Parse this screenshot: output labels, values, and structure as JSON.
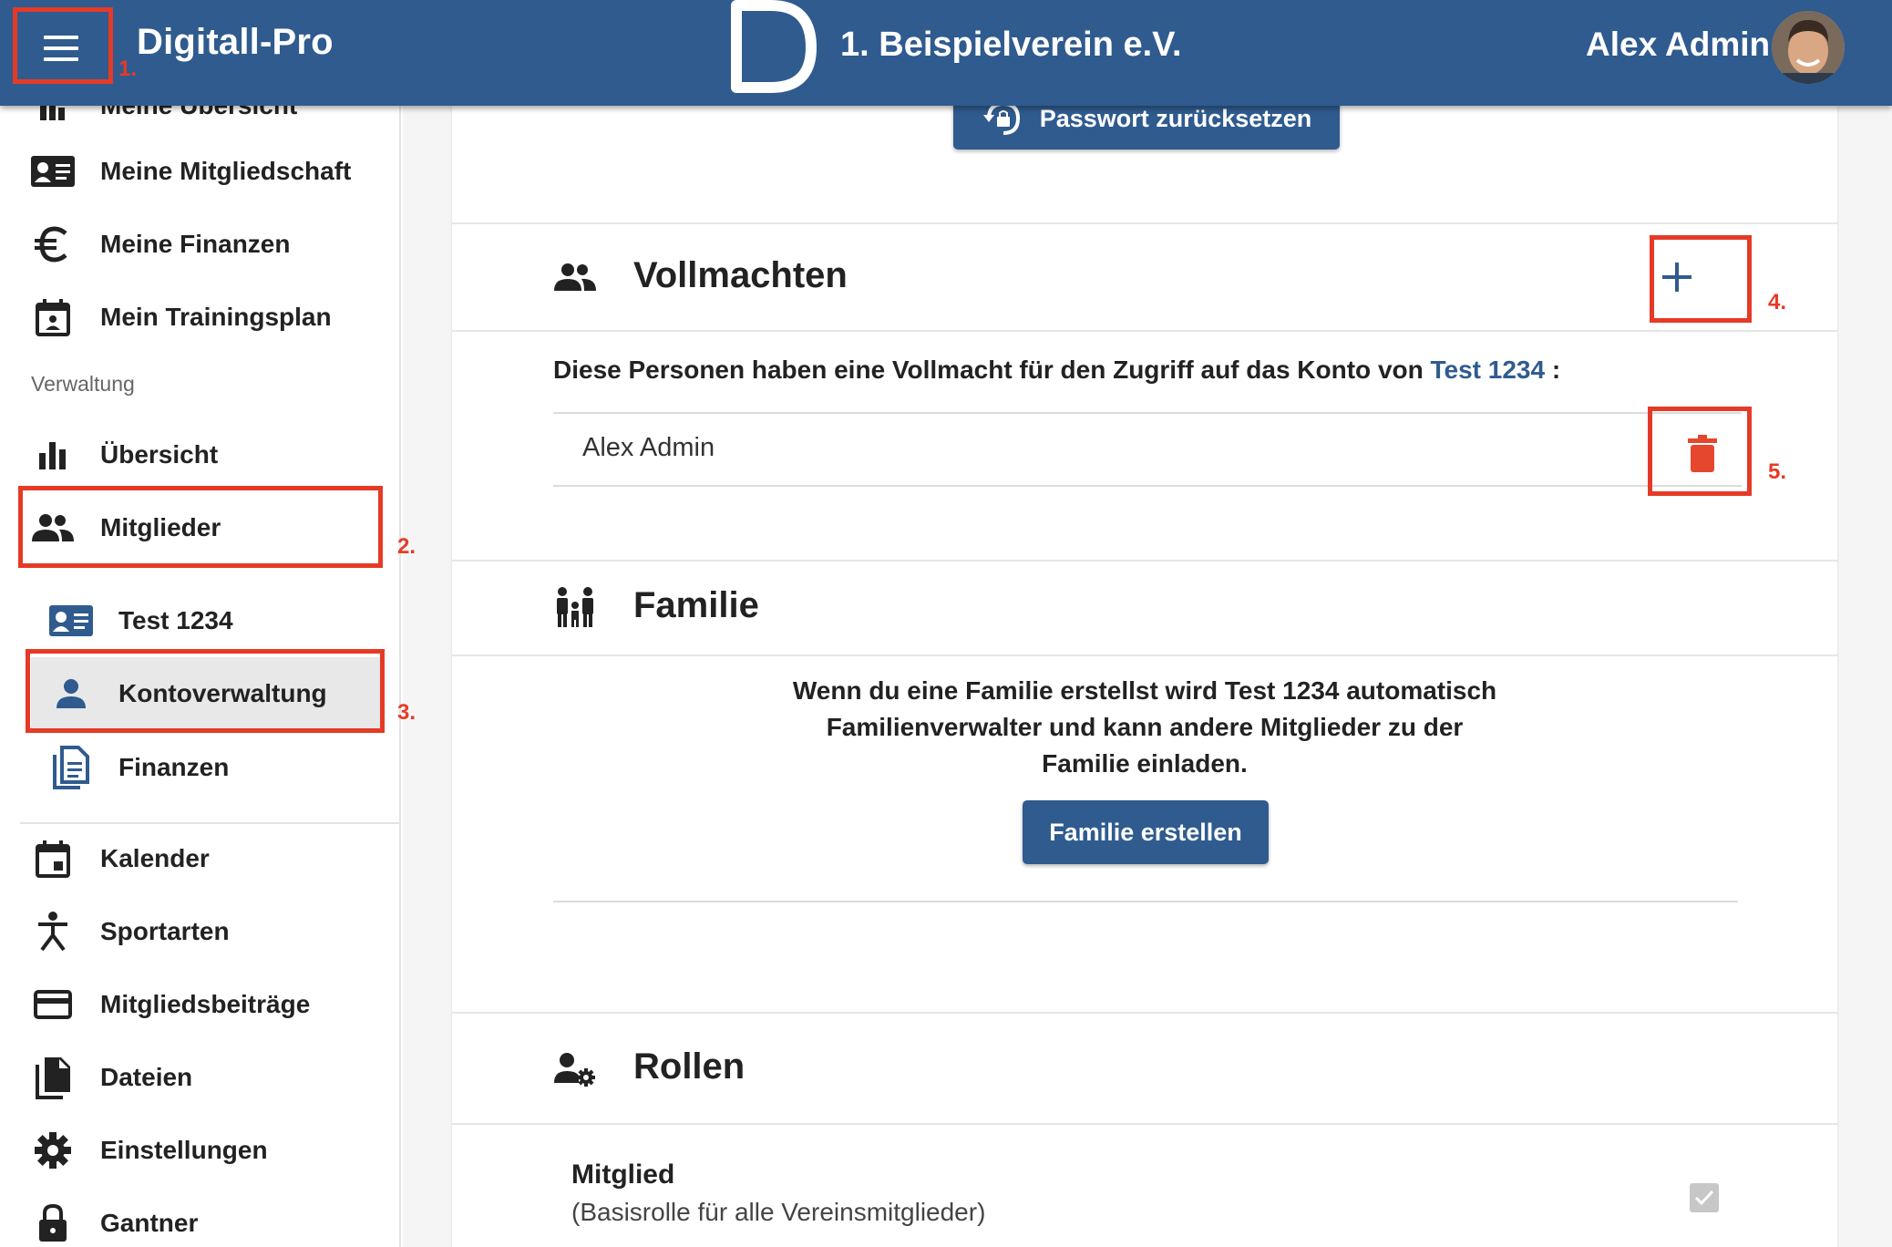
{
  "header": {
    "brand": "Digitall-Pro",
    "club_name": "1. Beispielverein e.V.",
    "user_name": "Alex Admin"
  },
  "sidebar": {
    "top_cut_label": "Meine Übersicht",
    "items_my": [
      {
        "label": "Meine Mitgliedschaft",
        "icon": "id-card-icon"
      },
      {
        "label": "Meine Finanzen",
        "icon": "euro-icon"
      },
      {
        "label": "Mein Trainingsplan",
        "icon": "calendar-person-icon"
      }
    ],
    "section_label": "Verwaltung",
    "items_admin": [
      {
        "label": "Übersicht",
        "icon": "bar-chart-icon"
      },
      {
        "label": "Mitglieder",
        "icon": "people-icon"
      }
    ],
    "sub_items": [
      {
        "label": "Test 1234",
        "icon": "id-card-icon"
      },
      {
        "label": "Kontoverwaltung",
        "icon": "person-icon"
      },
      {
        "label": "Finanzen",
        "icon": "document-icon"
      }
    ],
    "items_more": [
      {
        "label": "Kalender",
        "icon": "calendar-icon"
      },
      {
        "label": "Sportarten",
        "icon": "sport-icon"
      },
      {
        "label": "Mitgliedsbeiträge",
        "icon": "credit-card-icon"
      },
      {
        "label": "Dateien",
        "icon": "files-icon"
      },
      {
        "label": "Einstellungen",
        "icon": "gear-icon"
      },
      {
        "label": "Gantner",
        "icon": "lock-icon"
      }
    ]
  },
  "main": {
    "reset_password_label": "Passwort zurücksetzen",
    "vollmachten": {
      "title": "Vollmachten",
      "description_prefix": "Diese Personen haben eine Vollmacht für den Zugriff auf das Konto von",
      "description_link": "Test 1234",
      "description_suffix": ":",
      "persons": [
        "Alex Admin"
      ]
    },
    "familie": {
      "title": "Familie",
      "text_line1": "Wenn du eine Familie erstellst wird Test 1234 automatisch",
      "text_line2": "Familienverwalter und kann andere Mitglieder zu der",
      "text_line3": "Familie einladen.",
      "button_label": "Familie erstellen"
    },
    "rollen": {
      "title": "Rollen",
      "role_name": "Mitglied",
      "role_desc": "(Basisrolle für alle Vereinsmitglieder)"
    }
  },
  "annotations": [
    "1.",
    "2.",
    "3.",
    "4.",
    "5."
  ],
  "colors": {
    "primary": "#2f5b8f",
    "highlight": "#e53a26",
    "delete": "#e5472e"
  }
}
